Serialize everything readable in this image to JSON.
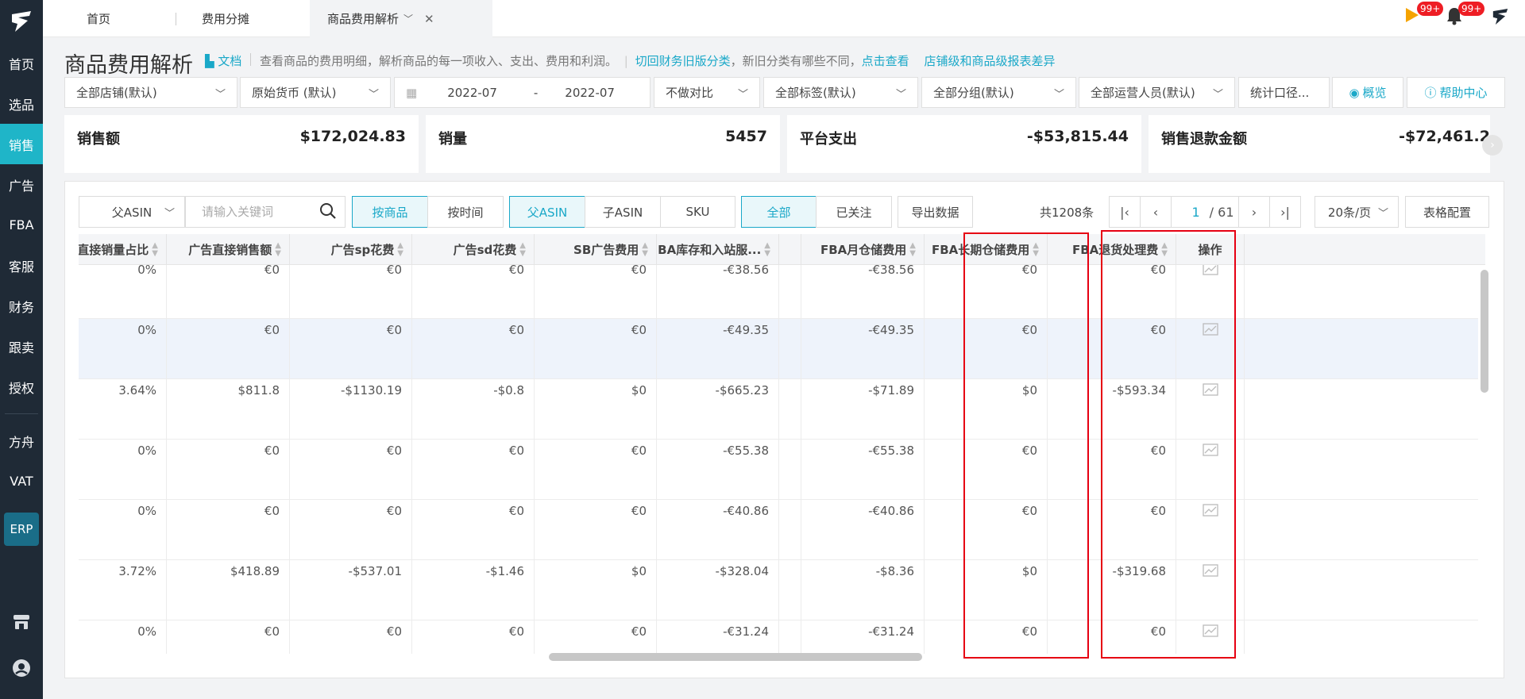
{
  "sidebar": {
    "logo_icon": "logo-icon",
    "items": [
      {
        "label": "首页"
      },
      {
        "label": "选品"
      },
      {
        "label": "销售"
      },
      {
        "label": "广告"
      },
      {
        "label": "FBA"
      },
      {
        "label": "客服"
      },
      {
        "label": "财务"
      },
      {
        "label": "跟卖"
      },
      {
        "label": "授权"
      },
      {
        "label": "方舟"
      },
      {
        "label": "VAT"
      }
    ],
    "erp_label": "ERP",
    "active_item": "销售"
  },
  "tabs": [
    {
      "label": "首页"
    },
    {
      "label": "费用分摊"
    },
    {
      "label": "商品费用解析"
    }
  ],
  "notifications": {
    "flag_badge": "99+",
    "bell_badge": "99+"
  },
  "header": {
    "title": "商品费用解析",
    "doc_link": "文档",
    "desc_prefix": "查看商品的费用明细，解析商品的每一项收入、支出、费用和利润。",
    "desc_link1": "切回财务旧版分类",
    "desc_mid": "，新旧分类有哪些不同，",
    "desc_link2": "点击查看",
    "desc_link3": "店铺级和商品级报表差异"
  },
  "filters": {
    "store": "全部店铺(默认)",
    "currency": "原始货币 (默认)",
    "date_start": "2022-07",
    "date_sep": "-",
    "date_end": "2022-07",
    "compare": "不做对比",
    "tags": "全部标签(默认)",
    "groups": "全部分组(默认)",
    "operators": "全部运营人员(默认)",
    "stat_scope": "统计口径...",
    "overview_btn": "概览",
    "help_btn": "帮助中心"
  },
  "stats": [
    {
      "label": "销售额",
      "value": "$172,024.83"
    },
    {
      "label": "销量",
      "value": "5457"
    },
    {
      "label": "平台支出",
      "value": "-$53,815.44"
    },
    {
      "label": "销售退款金额",
      "value": "-$72,461.2"
    }
  ],
  "toolbar": {
    "asin_select": "父ASIN",
    "search_placeholder": "请输入关键词",
    "by_product": "按商品",
    "by_time": "按时间",
    "parent_asin": "父ASIN",
    "child_asin": "子ASIN",
    "sku": "SKU",
    "all": "全部",
    "followed": "已关注",
    "export": "导出数据",
    "total": "共1208条",
    "page_current": "1",
    "page_total": "/ 61",
    "page_size": "20条/页",
    "table_config": "表格配置"
  },
  "table": {
    "columns": [
      "告直接销量占比",
      "广告直接销售额",
      "广告sp花费",
      "广告sd花费",
      "SB广告费用",
      "FBA库存和入站服...",
      "FBA月仓储费用",
      "FBA长期仓储费用",
      "FBA退货处理费",
      "操作"
    ],
    "rows": [
      [
        "0%",
        "€0",
        "€0",
        "€0",
        "€0",
        "-€38.56",
        "-€38.56",
        "€0",
        "€0"
      ],
      [
        "0%",
        "€0",
        "€0",
        "€0",
        "€0",
        "-€49.35",
        "-€49.35",
        "€0",
        "€0"
      ],
      [
        "3.64%",
        "$811.8",
        "-$1130.19",
        "-$0.8",
        "$0",
        "-$665.23",
        "-$71.89",
        "$0",
        "-$593.34"
      ],
      [
        "0%",
        "€0",
        "€0",
        "€0",
        "€0",
        "-€55.38",
        "-€55.38",
        "€0",
        "€0"
      ],
      [
        "0%",
        "€0",
        "€0",
        "€0",
        "€0",
        "-€40.86",
        "-€40.86",
        "€0",
        "€0"
      ],
      [
        "3.72%",
        "$418.89",
        "-$537.01",
        "-$1.46",
        "$0",
        "-$328.04",
        "-$8.36",
        "$0",
        "-$319.68"
      ],
      [
        "0%",
        "€0",
        "€0",
        "€0",
        "€0",
        "-€31.24",
        "-€31.24",
        "€0",
        "€0"
      ]
    ],
    "action_icon": "chart-icon",
    "highlight_color": "#e60012"
  }
}
